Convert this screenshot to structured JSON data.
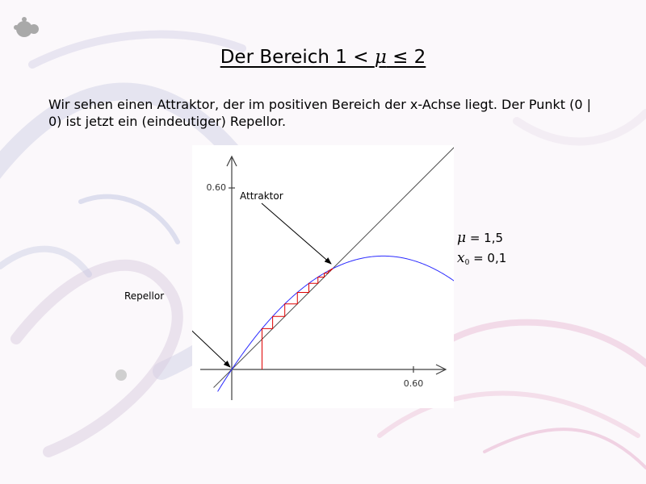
{
  "slide": {
    "title_prefix": "Der Bereich 1 < ",
    "title_mu": "μ",
    "title_suffix": " ≤ 2",
    "intro": "Wir sehen einen Attraktor, der im positiven Bereich der x-Achse liegt. Der Punkt (0 | 0) ist jetzt ein (eindeutiger) Repellor."
  },
  "chart_data": {
    "type": "line",
    "function": "f(x) = μ·x·(1 − x)",
    "mu": 1.5,
    "x0": 0.1,
    "xlim": [
      -0.06,
      0.84
    ],
    "ylim": [
      -0.08,
      0.6
    ],
    "x_tick_label": "0.60",
    "y_tick_label": "0.60",
    "x_tick_value": 0.6,
    "y_tick_value": 0.6,
    "fixed_points": [
      {
        "name": "Repellor",
        "x": 0,
        "y": 0
      },
      {
        "name": "Attraktor",
        "x": 0.333,
        "y": 0.333
      }
    ],
    "series": [
      {
        "color": "#2a2aff"
      },
      {
        "color": "#505050"
      },
      {
        "color": "#e00000"
      }
    ],
    "cobweb_steps": 22
  },
  "annotations": {
    "attraktor": "Attraktor",
    "repellor": "Repellor"
  },
  "params": {
    "mu_symbol": "μ",
    "mu_value": " = 1,5",
    "x_symbol": "x",
    "x_subscript": "0",
    "x_value": " = 0,1"
  }
}
